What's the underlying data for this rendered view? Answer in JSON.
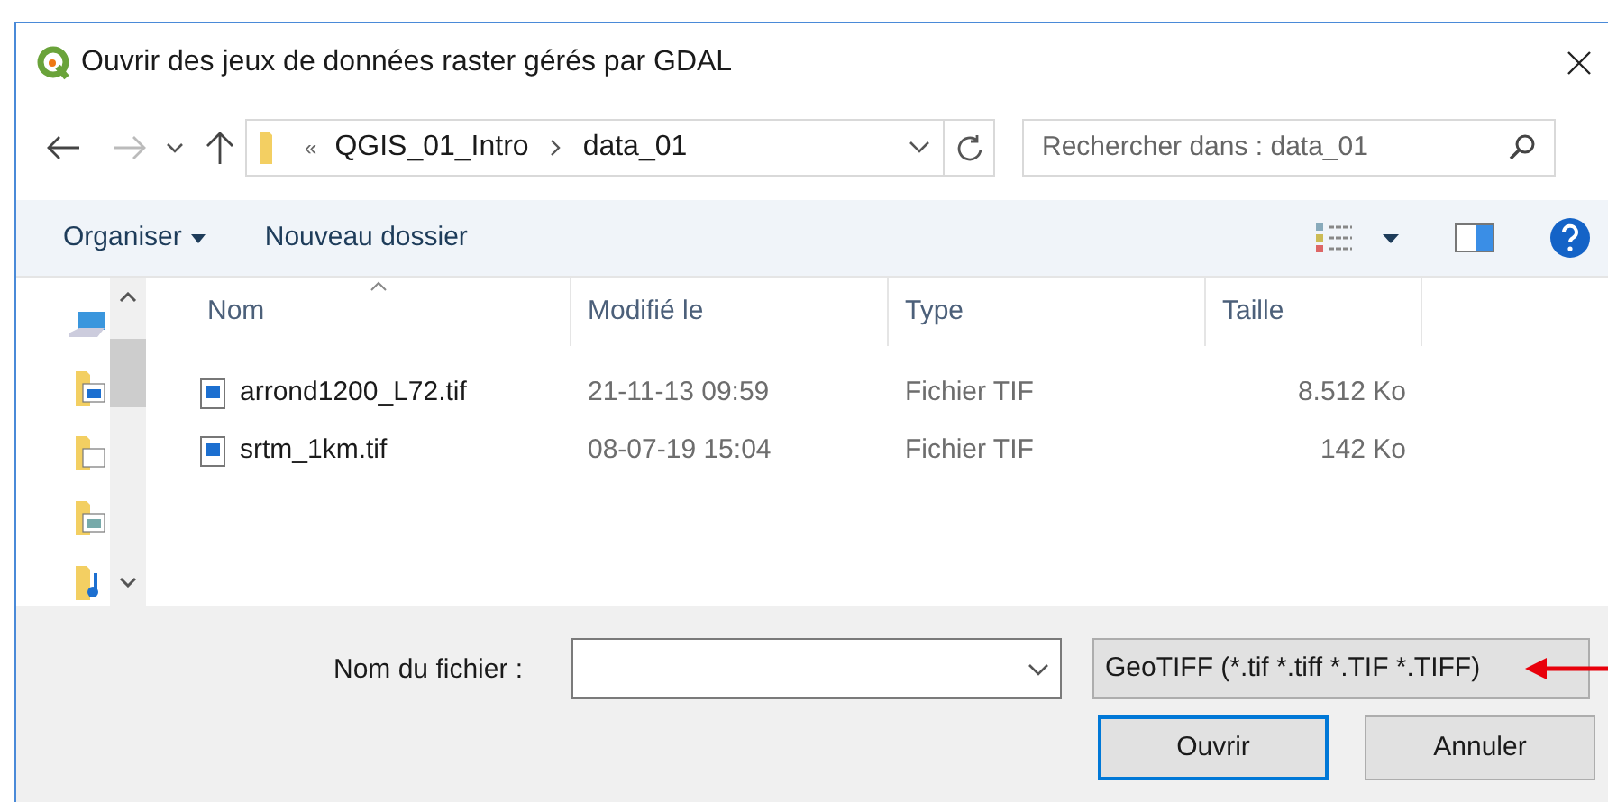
{
  "window": {
    "title": "Ouvrir des jeux de données raster gérés par GDAL"
  },
  "address": {
    "overflow": "«",
    "crumbs": [
      "QGIS_01_Intro",
      "data_01"
    ]
  },
  "search": {
    "placeholder": "Rechercher dans : data_01"
  },
  "toolbar": {
    "organize": "Organiser",
    "new_folder": "Nouveau dossier"
  },
  "table": {
    "columns": [
      "Nom",
      "Modifié le",
      "Type",
      "Taille"
    ],
    "rows": [
      {
        "name": "arrond1200_L72.tif",
        "modified": "21-11-13 09:59",
        "type": "Fichier TIF",
        "size": "8.512 Ko"
      },
      {
        "name": "srtm_1km.tif",
        "modified": "08-07-19 15:04",
        "type": "Fichier TIF",
        "size": "142 Ko"
      }
    ]
  },
  "footer": {
    "filename_label": "Nom du fichier :",
    "filter": "GeoTIFF (*.tif *.tiff *.TIF *.TIFF)",
    "buttons": [
      {
        "label": "Ouvrir",
        "selected": true
      },
      {
        "label": "Annuler",
        "selected": false
      }
    ]
  }
}
